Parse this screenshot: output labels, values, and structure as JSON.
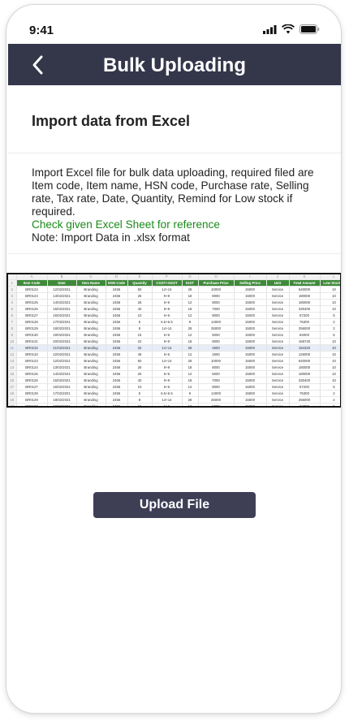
{
  "status_bar": {
    "time": "9:41"
  },
  "header": {
    "title": "Bulk Uploading"
  },
  "section": {
    "title": "Import data from Excel"
  },
  "instructions": {
    "text": "Import Excel file for bulk data uploading, required filed are Item code, Item name, HSN code, Purchase rate, Selling rate, Tax rate, Date, Quantity, Remind for Low stock if required.",
    "reference": "Check given Excel Sheet for reference",
    "note": "Note: Import Data in .xlsx format"
  },
  "sheet": {
    "column_letters": [
      "A",
      "B",
      "C",
      "D",
      "E",
      "F",
      "G",
      "H",
      "I",
      "J",
      "K",
      "L"
    ],
    "headers": [
      "Item Code",
      "Date",
      "Item Name",
      "HSN Code",
      "Quantity",
      "CGST+SGST",
      "IGST",
      "Purchase Price",
      "Selling Price",
      "Unit",
      "Total Amount",
      "Low Stock al"
    ],
    "rows": [
      [
        "BR0123",
        "12/02/2021",
        "Branding",
        "2456",
        "50",
        "14+14",
        "28",
        "10000",
        "15000",
        "Service",
        "640000",
        "10"
      ],
      [
        "BR0124",
        "13/02/2021",
        "Branding",
        "2456",
        "26",
        "9+9",
        "18",
        "8000",
        "15000",
        "Service",
        "180000",
        "10"
      ],
      [
        "BR0125",
        "14/02/2021",
        "Branding",
        "2456",
        "26",
        "6+6",
        "12",
        "8000",
        "15000",
        "Service",
        "180000",
        "10"
      ],
      [
        "BR0126",
        "15/02/2021",
        "Branding",
        "2456",
        "40",
        "9+9",
        "18",
        "7000",
        "15000",
        "Service",
        "330400",
        "10"
      ],
      [
        "BR0127",
        "16/02/2021",
        "Branding",
        "2456",
        "10",
        "6+6",
        "12",
        "8000",
        "15000",
        "Service",
        "57200",
        "5"
      ],
      [
        "BR0128",
        "17/02/2021",
        "Branding",
        "2456",
        "5",
        "6.5+6.5",
        "9",
        "14000",
        "15000",
        "Service",
        "75300",
        "2"
      ],
      [
        "BR0129",
        "18/02/2021",
        "Branding",
        "2456",
        "8",
        "14+14",
        "28",
        "25000",
        "15000",
        "Service",
        "256000",
        "2"
      ],
      [
        "BR0130",
        "19/02/2021",
        "Branding",
        "2456",
        "15",
        "6+6",
        "12",
        "5000",
        "15000",
        "Service",
        "84000",
        "5"
      ],
      [
        "BR0131",
        "20/02/2021",
        "Branding",
        "2456",
        "22",
        "9+9",
        "18",
        "8000",
        "15000",
        "Service",
        "168740",
        "10"
      ],
      [
        "BR0132",
        "21/02/2021",
        "Branding",
        "2456",
        "32",
        "14+14",
        "28",
        "4500",
        "15000",
        "Service",
        "184320",
        "10"
      ],
      [
        "BR0133",
        "22/02/2021",
        "Branding",
        "2456",
        "45",
        "6+6",
        "12",
        "2600",
        "15000",
        "Service",
        "126000",
        "10"
      ],
      [
        "BR0123",
        "12/02/2021",
        "Branding",
        "2456",
        "50",
        "14+14",
        "28",
        "10000",
        "15000",
        "Service",
        "640000",
        "10"
      ],
      [
        "BR0124",
        "13/02/2021",
        "Branding",
        "2456",
        "26",
        "9+9",
        "18",
        "8000",
        "15000",
        "Service",
        "180000",
        "10"
      ],
      [
        "BR0125",
        "14/02/2021",
        "Branding",
        "2456",
        "26",
        "6+6",
        "12",
        "5000",
        "15000",
        "Service",
        "180000",
        "10"
      ],
      [
        "BR0126",
        "15/02/2021",
        "Branding",
        "2456",
        "40",
        "9+9",
        "18",
        "7000",
        "15000",
        "Service",
        "330400",
        "10"
      ],
      [
        "BR0127",
        "16/02/2021",
        "Branding",
        "2456",
        "10",
        "6+6",
        "12",
        "8000",
        "15000",
        "Service",
        "57200",
        "5"
      ],
      [
        "BR0128",
        "17/02/2021",
        "Branding",
        "2456",
        "5",
        "6.5+6.5",
        "9",
        "14000",
        "15000",
        "Service",
        "75300",
        "2"
      ],
      [
        "BR0129",
        "18/02/2021",
        "Branding",
        "2456",
        "8",
        "14+14",
        "28",
        "25000",
        "15000",
        "Service",
        "256000",
        "2"
      ],
      [
        "BR0130",
        "19/02/2021",
        "Branding",
        "2456",
        "15",
        "6+6",
        "12",
        "5000",
        "15000",
        "Service",
        "84000",
        "5"
      ]
    ]
  },
  "upload": {
    "label": "Upload File"
  }
}
